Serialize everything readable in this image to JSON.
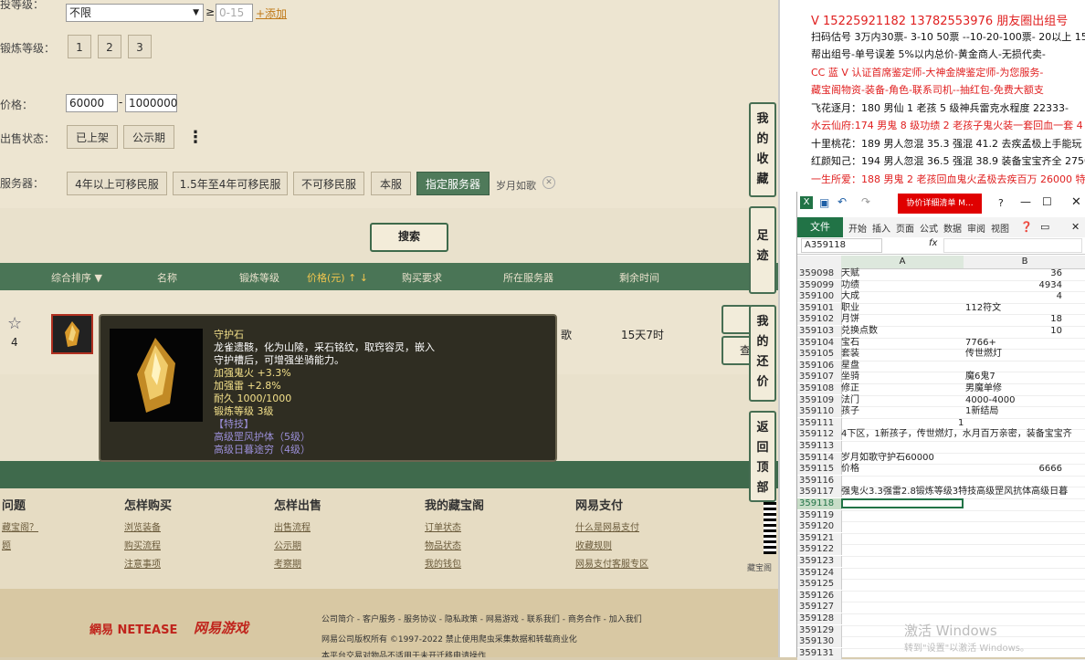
{
  "filters": {
    "row1_label": "投等级：",
    "row1_select": "不限",
    "row1_op": "≥",
    "row1_placeholder": "0-15",
    "row1_add": "+添加",
    "forge_label": "锻炼等级：",
    "forge_opts": [
      "1",
      "2",
      "3"
    ],
    "price_label": "价格：",
    "price_min": "60000",
    "price_sep": "-",
    "price_max": "1000000",
    "status_label": "出售状态：",
    "status_opts": [
      "已上架",
      "公示期"
    ],
    "more": "⋮",
    "server_label": "服务器：",
    "server_opts": [
      "4年以上可移民服",
      "1.5年至4年可移民服",
      "不可移民服",
      "本服",
      "指定服务器"
    ],
    "server_selected": "岁月如歌",
    "search": "搜索"
  },
  "table": {
    "headers": [
      "综合排序 ▼",
      "名称",
      "锻炼等级",
      "价格(元) ↑ ↓",
      "购买要求",
      "所在服务器",
      "剩余时间"
    ],
    "row": {
      "fav_count": "4",
      "server_tail": "歌",
      "time_left": "15天7时"
    }
  },
  "tooltip": {
    "title": "守护石",
    "desc1": "龙雀遗骸，化为山陵，采石铭纹，取窍容灵，嵌入",
    "desc2": "守护槽后，可增强坐骑能力。",
    "attr1": "加强鬼火 +3.3%",
    "attr2": "加强雷 +2.8%",
    "dur": "耐久 1000/1000",
    "forge": "锻炼等级 3级",
    "special_h": "【特技】",
    "sp1": "高级罡风护体（5级）",
    "sp2": "高级日暮途穷（4级）"
  },
  "sidetabs": {
    "fav": "我的收藏",
    "foot": "足迹",
    "bargain": "我的还价",
    "top": "返回顶部",
    "check": "查"
  },
  "footer": {
    "cols": [
      {
        "h": "问题",
        "links": [
          "藏宝阁？",
          "题"
        ]
      },
      {
        "h": "怎样购买",
        "links": [
          "浏览装备",
          "购买流程",
          "注意事项"
        ]
      },
      {
        "h": "怎样出售",
        "links": [
          "出售流程",
          "公示期",
          "考察期"
        ]
      },
      {
        "h": "我的藏宝阁",
        "links": [
          "订单状态",
          "物品状态",
          "我的钱包"
        ]
      },
      {
        "h": "网易支付",
        "links": [
          "什么是网易支付",
          "收藏规则",
          "网易支付客服专区"
        ]
      }
    ],
    "brand1": "網易 NETEASE",
    "brand2": "网易游戏",
    "links_line": "公司简介 - 客户服务 - 服务协议 - 隐私政策 - 网易游戏 - 联系我们 - 商务合作 - 加入我们",
    "copyright": "网易公司版权所有 ©1997-2022  禁止使用爬虫采集数据和转载商业化",
    "notice": "本平台交易对物品不适用于未开迁移申请操作",
    "qr_label": "藏宝阁"
  },
  "notes": {
    "lines": [
      {
        "text": "V 15225921182    13782553976 朋友圈出组号",
        "color": "#e02020"
      },
      {
        "text": "扫码估号 3万内30票- 3-10 50票  --10-20-100票- 20以上 15",
        "color": "#111111"
      },
      {
        "text": "帮出组号-单号误差 5%以内总价-黄金商人-无损代卖-",
        "color": "#111111"
      },
      {
        "text": "CC 蓝 V 认证首席鉴定师-大神金牌鉴定师-为您服务-",
        "color": "#e02020"
      },
      {
        "text": "藏宝阁物资-装备-角色-联系司机--抽红包-免费大额支",
        "color": "#e02020"
      },
      {
        "text": "飞花逐月：180 男仙 1 老孩 5 级神兵雷克水程度 22333-",
        "color": "#111111"
      },
      {
        "text": "水云仙府:174 男鬼 8 级功绩 2 老孩子鬼火装一套回血一套 4",
        "color": "#e02020"
      },
      {
        "text": "十里桃花：189 男人忽混 35.3 强混 41.2 去疾孟极上手能玩 2",
        "color": "#111111"
      },
      {
        "text": "红颜知己：194 男人忽混 36.5 强混 38.9 装备宝宝齐全 27500",
        "color": "#111111"
      },
      {
        "text": "一生所爱：188 男鬼 2 老孩回血鬼火孟极去疾百万 26000 特",
        "color": "#e02020"
      }
    ]
  },
  "excel": {
    "title_badge": "协价详细清单 M...",
    "file": "文件",
    "tabs": [
      "开始",
      "插入",
      "页面",
      "公式",
      "数据",
      "审阅",
      "视图"
    ],
    "namebox": "A359118",
    "fx": "fx",
    "col_a": "A",
    "col_b": "B",
    "rows": [
      {
        "n": "359098",
        "a": "天赋",
        "b": "36",
        "br": true
      },
      {
        "n": "359099",
        "a": "功绩",
        "b": "4934",
        "br": true
      },
      {
        "n": "359100",
        "a": "大成",
        "b": "4",
        "br": true
      },
      {
        "n": "359101",
        "a": "职业",
        "b": "112符文",
        "br": false
      },
      {
        "n": "359102",
        "a": "月饼",
        "b": "18",
        "br": true
      },
      {
        "n": "359103",
        "a": "兑换点数",
        "b": "10",
        "br": true
      },
      {
        "n": "359104",
        "a": "宝石",
        "b": "7766+",
        "br": false
      },
      {
        "n": "359105",
        "a": "套装",
        "b": "传世燃灯",
        "br": false
      },
      {
        "n": "359106",
        "a": "星盘",
        "b": "",
        "br": false
      },
      {
        "n": "359107",
        "a": "坐骑",
        "b": "魔6鬼7",
        "br": false
      },
      {
        "n": "359108",
        "a": "修正",
        "b": "男魔单修",
        "br": false
      },
      {
        "n": "359109",
        "a": "法门",
        "b": "4000-4000",
        "br": false
      },
      {
        "n": "359110",
        "a": "孩子",
        "b": "1新结局",
        "br": false
      },
      {
        "n": "359111",
        "a": "",
        "b": "1",
        "br": "mid"
      },
      {
        "n": "359112",
        "a": "4下区，1新孩子，传世燃灯，水月百万亲密，装备宝宝齐",
        "b": "",
        "br": false
      },
      {
        "n": "359113",
        "a": "",
        "b": "",
        "br": false
      },
      {
        "n": "359114",
        "a": "岁月如歌守护石60000",
        "b": "",
        "br": false
      },
      {
        "n": "359115",
        "a": "价格",
        "b": "6666",
        "br": true
      },
      {
        "n": "359116",
        "a": "",
        "b": "",
        "br": false
      },
      {
        "n": "359117",
        "a": "强鬼火3.3强雷2.8锻炼等级3特技高级罡风抗体高级日暮",
        "b": "",
        "br": false
      },
      {
        "n": "359118",
        "a": "",
        "b": "",
        "br": false
      },
      {
        "n": "359119",
        "a": "",
        "b": "",
        "br": false
      },
      {
        "n": "359120",
        "a": "",
        "b": "",
        "br": false
      },
      {
        "n": "359121",
        "a": "",
        "b": "",
        "br": false
      },
      {
        "n": "359122",
        "a": "",
        "b": "",
        "br": false
      },
      {
        "n": "359123",
        "a": "",
        "b": "",
        "br": false
      },
      {
        "n": "359124",
        "a": "",
        "b": "",
        "br": false
      },
      {
        "n": "359125",
        "a": "",
        "b": "",
        "br": false
      },
      {
        "n": "359126",
        "a": "",
        "b": "",
        "br": false
      },
      {
        "n": "359127",
        "a": "",
        "b": "",
        "br": false
      },
      {
        "n": "359128",
        "a": "",
        "b": "",
        "br": false
      },
      {
        "n": "359129",
        "a": "",
        "b": "",
        "br": false
      },
      {
        "n": "359130",
        "a": "",
        "b": "",
        "br": false
      },
      {
        "n": "359131",
        "a": "",
        "b": "",
        "br": false
      }
    ]
  },
  "watermark": {
    "line1": "激活 Windows",
    "line2": "转到\"设置\"以激活 Windows。"
  }
}
